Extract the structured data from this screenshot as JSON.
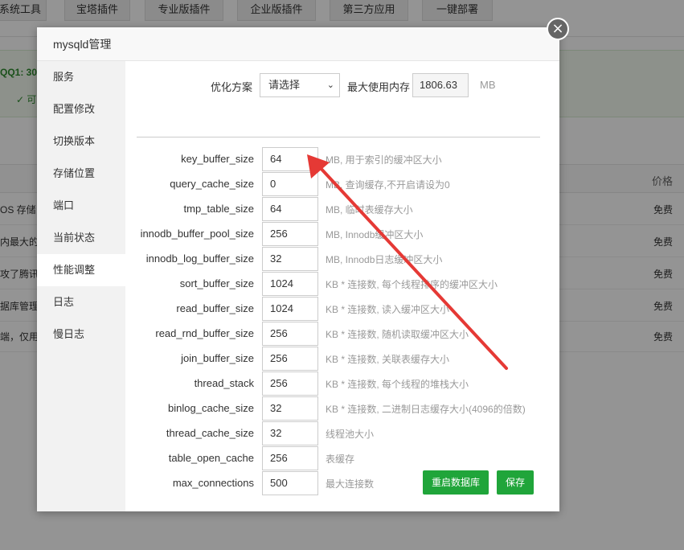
{
  "background": {
    "tabs": [
      "系统工具",
      "宝塔插件",
      "专业版插件",
      "企业版插件",
      "第三方应用",
      "一键部署"
    ],
    "notice_title": "QQ1: 30",
    "notice_sub": "可",
    "price_header": "价格",
    "rows": [
      {
        "text": "OS 存储",
        "price": "免费"
      },
      {
        "text": "内最大的",
        "price": "免费"
      },
      {
        "text": "攻了腾讯",
        "price": "免费"
      },
      {
        "text": "据库管理",
        "price": "免费"
      },
      {
        "text": "端，仅用",
        "price": "免费"
      }
    ]
  },
  "modal": {
    "title": "mysqld管理",
    "close_symbol": "×",
    "sidebar": [
      {
        "label": "服务",
        "active": false
      },
      {
        "label": "配置修改",
        "active": false
      },
      {
        "label": "切换版本",
        "active": false
      },
      {
        "label": "存储位置",
        "active": false
      },
      {
        "label": "端口",
        "active": false
      },
      {
        "label": "当前状态",
        "active": false
      },
      {
        "label": "性能调整",
        "active": true
      },
      {
        "label": "日志",
        "active": false
      },
      {
        "label": "慢日志",
        "active": false
      }
    ],
    "optimize": {
      "label": "优化方案",
      "select_value": "请选择",
      "max_mem_label": "最大使用内存",
      "max_mem_value": "1806.63",
      "max_mem_unit": "MB"
    },
    "params": [
      {
        "name": "key_buffer_size",
        "value": "64",
        "desc": "MB, 用于索引的缓冲区大小"
      },
      {
        "name": "query_cache_size",
        "value": "0",
        "desc": "MB, 查询缓存,不开启请设为0"
      },
      {
        "name": "tmp_table_size",
        "value": "64",
        "desc": "MB, 临时表缓存大小"
      },
      {
        "name": "innodb_buffer_pool_size",
        "value": "256",
        "desc": "MB, Innodb缓冲区大小"
      },
      {
        "name": "innodb_log_buffer_size",
        "value": "32",
        "desc": "MB, Innodb日志缓冲区大小"
      },
      {
        "name": "sort_buffer_size",
        "value": "1024",
        "desc": "KB * 连接数, 每个线程排序的缓冲区大小"
      },
      {
        "name": "read_buffer_size",
        "value": "1024",
        "desc": "KB * 连接数, 读入缓冲区大小"
      },
      {
        "name": "read_rnd_buffer_size",
        "value": "256",
        "desc": "KB * 连接数, 随机读取缓冲区大小"
      },
      {
        "name": "join_buffer_size",
        "value": "256",
        "desc": "KB * 连接数, 关联表缓存大小"
      },
      {
        "name": "thread_stack",
        "value": "256",
        "desc": "KB * 连接数, 每个线程的堆栈大小"
      },
      {
        "name": "binlog_cache_size",
        "value": "32",
        "desc": "KB * 连接数, 二进制日志缓存大小(4096的倍数)"
      },
      {
        "name": "thread_cache_size",
        "value": "32",
        "desc": "线程池大小"
      },
      {
        "name": "table_open_cache",
        "value": "256",
        "desc": "表缓存"
      },
      {
        "name": "max_connections",
        "value": "500",
        "desc": "最大连接数"
      }
    ],
    "buttons": {
      "restart": "重启数据库",
      "save": "保存"
    }
  },
  "colors": {
    "accent_green": "#20a53a",
    "annotation_arrow": "#e53935"
  }
}
